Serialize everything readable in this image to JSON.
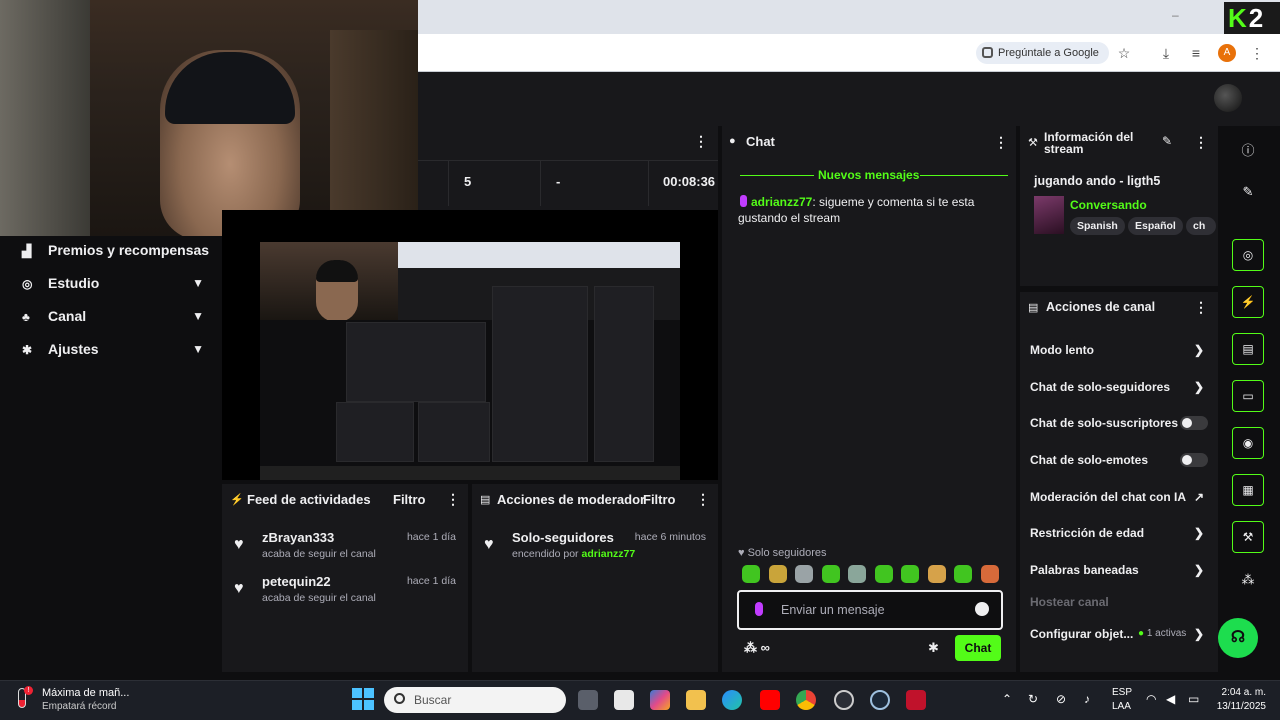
{
  "browser": {
    "ask_google": "Pregúntale a Google",
    "logo_text": "K",
    "logo_count": "2",
    "profile_initial": "A"
  },
  "sidebar": {
    "items": [
      {
        "label": "Premios y recompensas",
        "icon": "gift-icon",
        "chevron": false
      },
      {
        "label": "Estudio",
        "icon": "studio-icon",
        "chevron": true
      },
      {
        "label": "Canal",
        "icon": "channel-icon",
        "chevron": true
      },
      {
        "label": "Ajustes",
        "icon": "settings-icon",
        "chevron": true
      }
    ]
  },
  "stats": {
    "followers": "5",
    "subs": "-",
    "uptime": "00:08:36"
  },
  "feed": {
    "title": "Feed de actividades",
    "filter": "Filtro",
    "items": [
      {
        "name": "zBrayan333",
        "action": "acaba de seguir el canal",
        "time": "hace 1 día"
      },
      {
        "name": "petequin22",
        "action": "acaba de seguir el canal",
        "time": "hace 1 día"
      }
    ]
  },
  "mod": {
    "title": "Acciones de moderador",
    "filter": "Filtro",
    "item": {
      "name": "Solo-seguidores",
      "action_prefix": "encendido por",
      "by": "adrianzz77",
      "time": "hace 6 minutos"
    }
  },
  "chat": {
    "title": "Chat",
    "new_messages": "Nuevos mensajes",
    "messages": [
      {
        "user": "adrianzz77",
        "text": ": sigueme y comenta si te esta gustando el stream"
      }
    ],
    "followers_only": "Solo seguidores",
    "input_placeholder": "Enviar un mensaje",
    "send_label": "Chat",
    "tools": "∞"
  },
  "stream_info": {
    "title": "Información del stream",
    "stream_title": "jugando ando - ligth5",
    "category": "Conversando",
    "tags": [
      "Spanish",
      "Español",
      "ch"
    ]
  },
  "channel_actions": {
    "title": "Acciones de canal",
    "items": [
      {
        "label": "Modo lento",
        "type": "chevron"
      },
      {
        "label": "Chat de solo-seguidores",
        "type": "chevron"
      },
      {
        "label": "Chat de solo-suscriptores",
        "type": "toggle"
      },
      {
        "label": "Chat de solo-emotes",
        "type": "toggle"
      },
      {
        "label": "Moderación del chat con IA",
        "type": "external"
      },
      {
        "label": "Restricción de edad",
        "type": "chevron"
      },
      {
        "label": "Palabras baneadas",
        "type": "chevron"
      },
      {
        "label": "Hostear canal",
        "type": "disabled"
      },
      {
        "label": "Configurar objet...",
        "type": "chevron",
        "badge": "1 activas"
      }
    ]
  },
  "taskbar": {
    "weather_line1": "Máxima de mañ...",
    "weather_line2": "Empatará récord",
    "search_placeholder": "Buscar",
    "lang1": "ESP",
    "lang2": "LAA",
    "time": "2:04 a. m.",
    "date": "13/11/2025"
  },
  "colors": {
    "accent": "#53fc18",
    "panel": "#18181b",
    "background": "#0e0e10"
  }
}
